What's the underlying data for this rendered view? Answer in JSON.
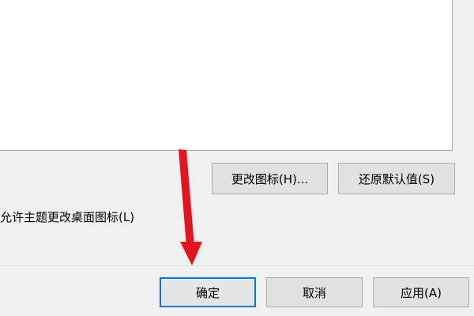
{
  "buttons": {
    "change_icon": "更改图标(H)...",
    "restore_default": "还原默认值(S)",
    "ok": "确定",
    "cancel": "取消",
    "apply": "应用(A)"
  },
  "checkbox": {
    "label": "允许主题更改桌面图标(L)"
  },
  "annotation": {
    "arrow_color": "#e3141c"
  }
}
